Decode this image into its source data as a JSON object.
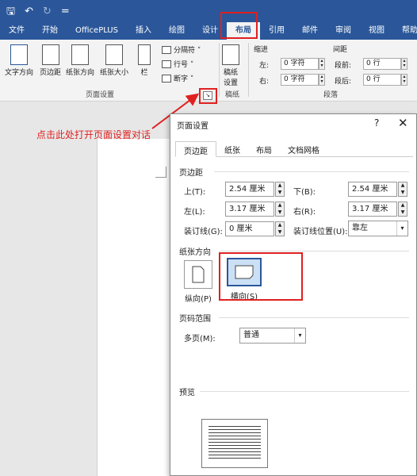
{
  "quick_access": {
    "save": "🖫",
    "undo": "↶",
    "redo": "↻",
    "customize": "="
  },
  "tabs": [
    "文件",
    "开始",
    "OfficePLUS",
    "插入",
    "绘图",
    "设计",
    "布局",
    "引用",
    "邮件",
    "审阅",
    "视图",
    "帮助"
  ],
  "ribbon": {
    "text_direction": "文字方向",
    "margins": "页边距",
    "orientation": "纸张方向",
    "size": "纸张大小",
    "columns": "栏",
    "breaks": "分隔符 ˅",
    "line_numbers": "行号 ˅",
    "hyphenation": "断字 ˅",
    "draft_paper_line1": "稿纸",
    "draft_paper_line2": "设置",
    "group_page_setup": "页面设置",
    "group_draft": "稿纸",
    "group_paragraph": "段落",
    "indent": "缩进",
    "spacing": "间距",
    "indent_left_label": "左:",
    "indent_left_value": "0 字符",
    "indent_right_label": "右:",
    "indent_right_value": "0 字符",
    "spacing_before_label": "段前:",
    "spacing_before_value": "0 行",
    "spacing_after_label": "段后:",
    "spacing_after_value": "0 行",
    "launcher_glyph": "↘"
  },
  "annotation": "点击此处打开页面设置对话",
  "dialog": {
    "title": "页面设置",
    "help": "?",
    "close": "✕",
    "tabs": [
      "页边距",
      "纸张",
      "布局",
      "文档网格"
    ],
    "margins_section": "页边距",
    "top_label": "上(T):",
    "top_value": "2.54 厘米",
    "bottom_label": "下(B):",
    "bottom_value": "2.54 厘米",
    "left_label": "左(L):",
    "left_value": "3.17 厘米",
    "right_label": "右(R):",
    "right_value": "3.17 厘米",
    "gutter_label": "装订线(G):",
    "gutter_value": "0 厘米",
    "gutter_pos_label": "装订线位置(U):",
    "gutter_pos_value": "靠左",
    "orientation_section": "纸张方向",
    "portrait": "纵向(P)",
    "landscape": "横向(S)",
    "pages_section": "页码范围",
    "multiple_pages_label": "多页(M):",
    "multiple_pages_value": "普通",
    "preview_section": "预览"
  },
  "colors": {
    "accent": "#2b579a",
    "highlight": "#e02020"
  }
}
